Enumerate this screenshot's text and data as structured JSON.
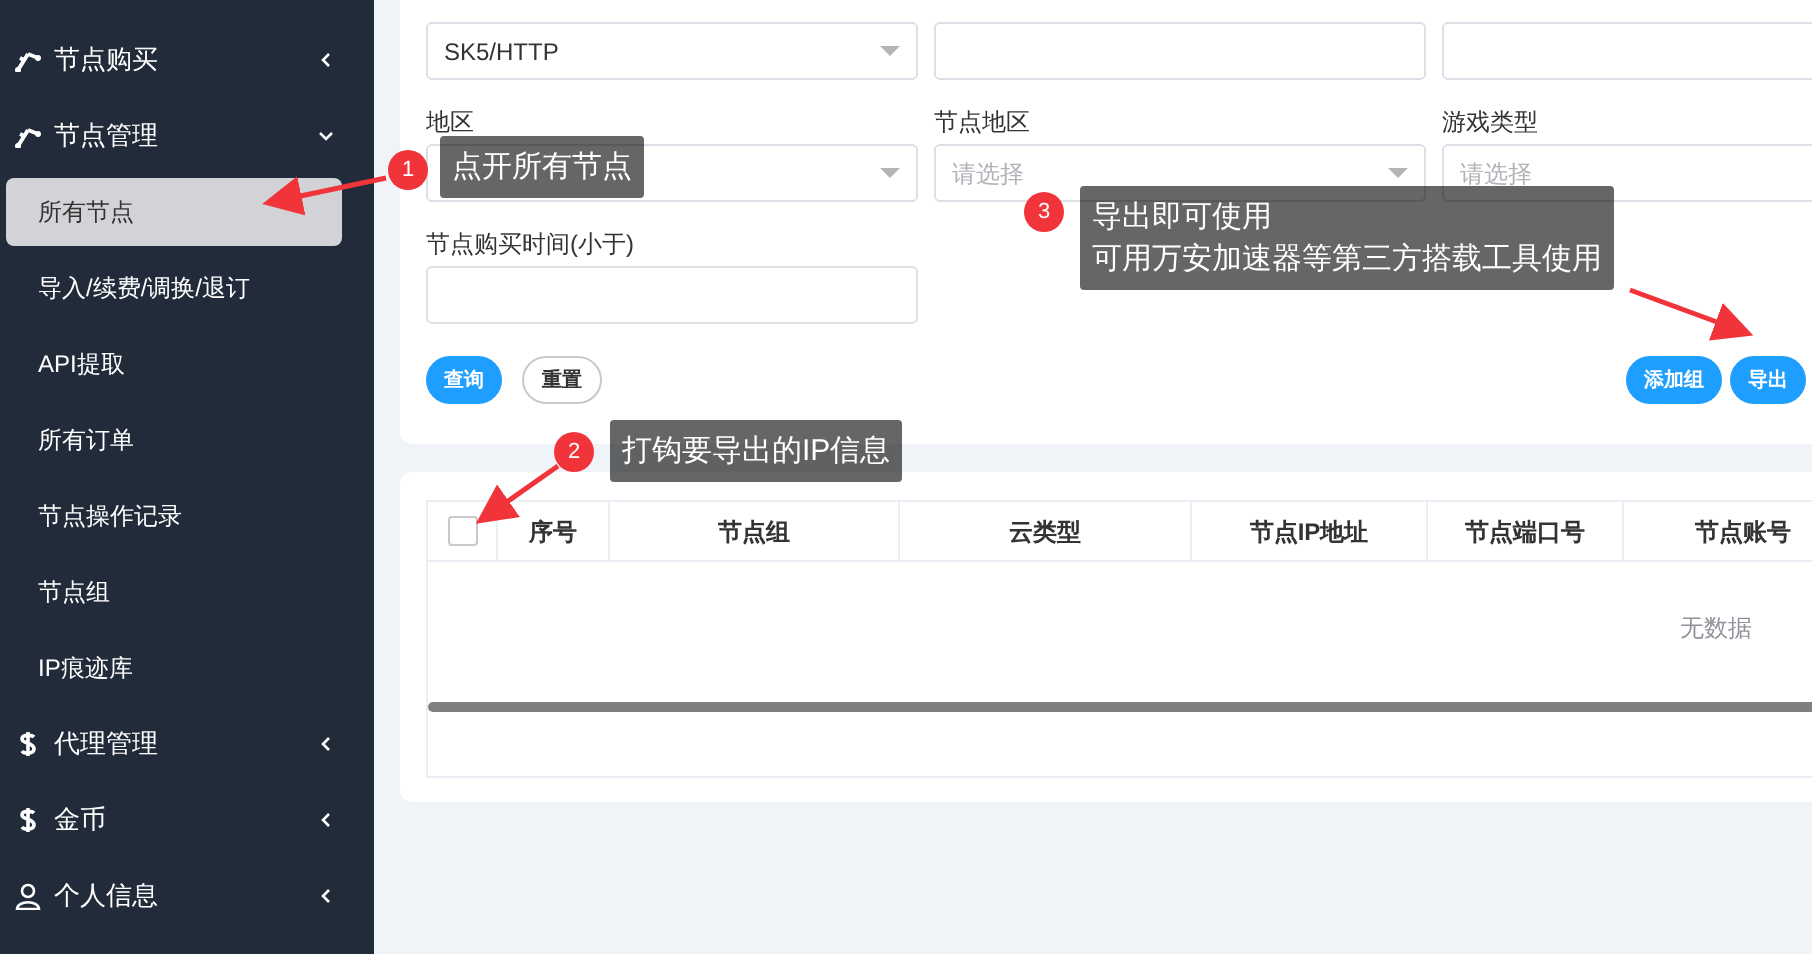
{
  "sidebar": {
    "items": [
      {
        "label": "节点购买",
        "kind": "nodes",
        "expanded": false
      },
      {
        "label": "节点管理",
        "kind": "nodes",
        "expanded": true,
        "children": [
          {
            "label": "所有节点",
            "selected": true
          },
          {
            "label": "导入/续费/调换/退订",
            "selected": false
          },
          {
            "label": "API提取",
            "selected": false
          },
          {
            "label": "所有订单",
            "selected": false
          },
          {
            "label": "节点操作记录",
            "selected": false
          },
          {
            "label": "节点组",
            "selected": false
          },
          {
            "label": "IP痕迹库",
            "selected": false
          }
        ]
      },
      {
        "label": "代理管理",
        "kind": "money",
        "expanded": false
      },
      {
        "label": "金币",
        "kind": "money",
        "expanded": false
      },
      {
        "label": "个人信息",
        "kind": "user",
        "expanded": false
      }
    ]
  },
  "filters": [
    {
      "kind": "select",
      "value": "SK5/HTTP"
    },
    {
      "kind": "text"
    },
    {
      "kind": "text"
    },
    {
      "label": "地区",
      "kind": "select"
    },
    {
      "label": "节点地区",
      "kind": "select",
      "placeholder": "请选择"
    },
    {
      "label": "游戏类型",
      "kind": "text",
      "placeholder": "请选择"
    },
    {
      "label": "节点购买时间(小于)",
      "kind": "text"
    }
  ],
  "left_buttons": [
    {
      "label": "查询",
      "kind": "primary"
    },
    {
      "label": "重置",
      "kind": "default"
    }
  ],
  "right_buttons": [
    {
      "label": "添加组",
      "kind": "primary"
    },
    {
      "label": "导出",
      "kind": "primary"
    }
  ],
  "table": {
    "columns": [
      {
        "kind": "checkbox",
        "checked": false
      },
      {
        "label": "序号"
      },
      {
        "label": "节点组"
      },
      {
        "label": "云类型"
      },
      {
        "label": "节点IP地址"
      },
      {
        "label": "节点端口号"
      },
      {
        "label": "节点账号"
      }
    ],
    "empty_text": "无数据"
  },
  "annotations": [
    {
      "number": "1",
      "lines": [
        "点开所有节点"
      ]
    },
    {
      "number": "2",
      "lines": [
        "打钩要导出的IP信息"
      ]
    },
    {
      "number": "3",
      "lines": [
        "导出即可使用",
        "可用万安加速器等第三方搭载工具使用"
      ]
    }
  ]
}
